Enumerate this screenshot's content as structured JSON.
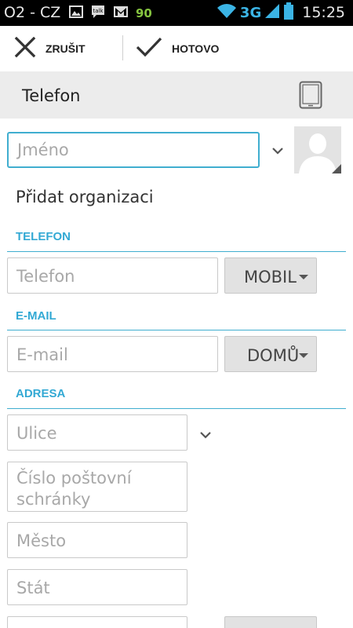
{
  "status_bar": {
    "carrier": "O2 - CZ",
    "notification_count": "90",
    "network_type": "3G",
    "time": "15:25"
  },
  "action_bar": {
    "cancel_label": "ZRUŠIT",
    "done_label": "HOTOVO"
  },
  "account": {
    "title": "Telefon",
    "icon": "phone-device-icon"
  },
  "name": {
    "placeholder": "Jméno"
  },
  "organization": {
    "label": "Přidat organizaci"
  },
  "sections": {
    "phone": {
      "header": "TELEFON",
      "placeholder": "Telefon",
      "type": "MOBIL"
    },
    "email": {
      "header": "E-MAIL",
      "placeholder": "E-mail",
      "type": "DOMŮ"
    },
    "address": {
      "header": "ADRESA",
      "street_placeholder": "Ulice",
      "pobox_placeholder": "Číslo poštovní schránky",
      "city_placeholder": "Město",
      "state_placeholder": "Stát"
    }
  },
  "colors": {
    "accent": "#33a9d4",
    "status_bar": "#000000",
    "account_row": "#ececec"
  }
}
